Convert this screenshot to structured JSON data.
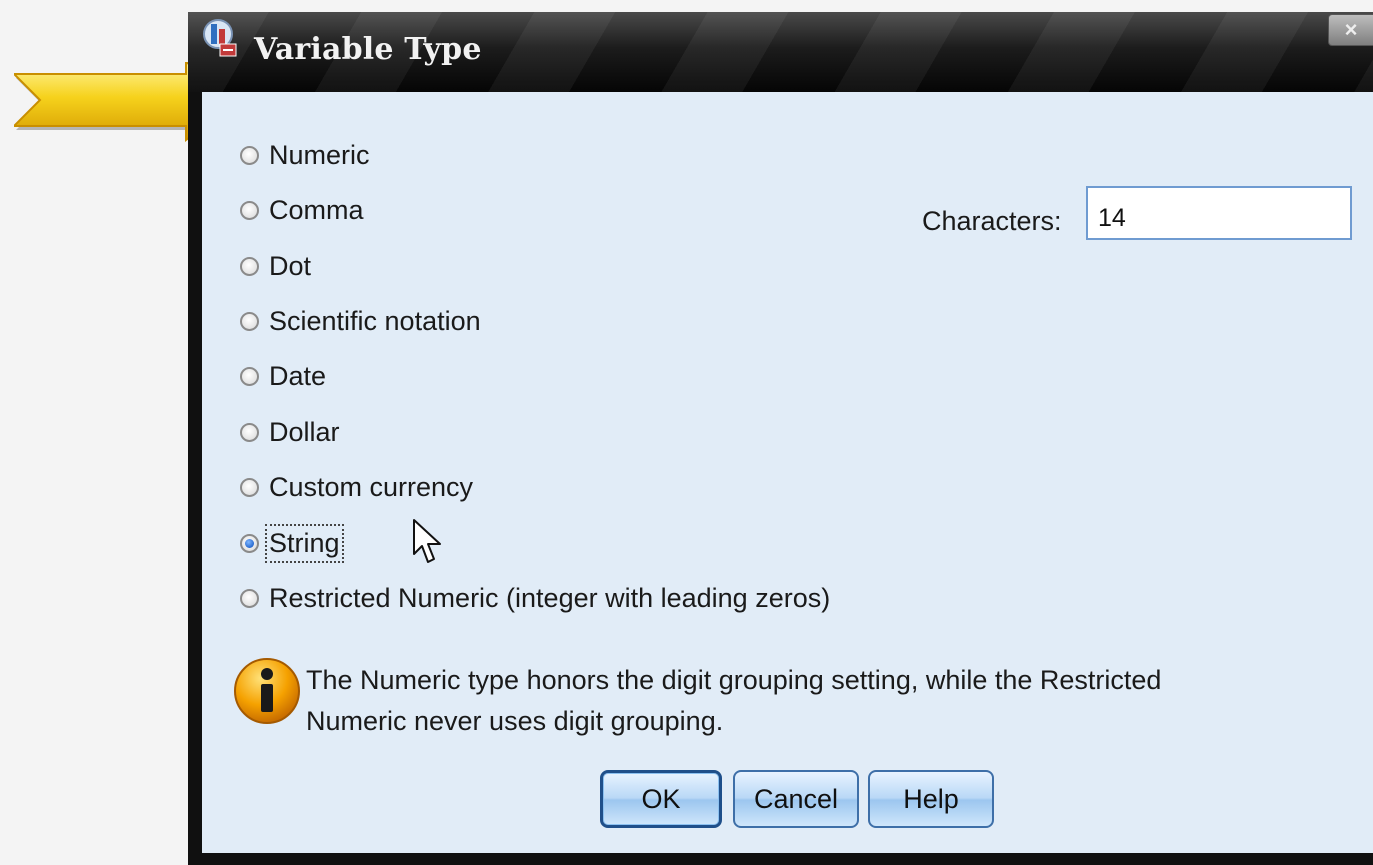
{
  "window": {
    "title": "Variable Type",
    "close_label": "×"
  },
  "type_options": [
    {
      "label": "Numeric",
      "checked": false
    },
    {
      "label": "Comma",
      "checked": false
    },
    {
      "label": "Dot",
      "checked": false
    },
    {
      "label": "Scientific notation",
      "checked": false
    },
    {
      "label": "Date",
      "checked": false
    },
    {
      "label": "Dollar",
      "checked": false
    },
    {
      "label": "Custom currency",
      "checked": false
    },
    {
      "label": "String",
      "checked": true
    },
    {
      "label": "Restricted Numeric (integer with leading zeros)",
      "checked": false
    }
  ],
  "characters": {
    "label": "Characters:",
    "value": "14"
  },
  "note": {
    "line1": "The Numeric type honors the digit grouping setting, while the Restricted",
    "line2": "Numeric never uses digit grouping."
  },
  "buttons": {
    "ok": "OK",
    "cancel": "Cancel",
    "help": "Help"
  },
  "icons": {
    "app": "spss-app-icon",
    "info": "info-icon",
    "pointer": "yellow-arrow-icon",
    "cursor": "mouse-cursor-icon"
  },
  "colors": {
    "dialog_background": "#e1ecf7",
    "titlebar": "#1c1c1c",
    "button_border": "#3e6fa8",
    "arrow": "#f2c418"
  }
}
